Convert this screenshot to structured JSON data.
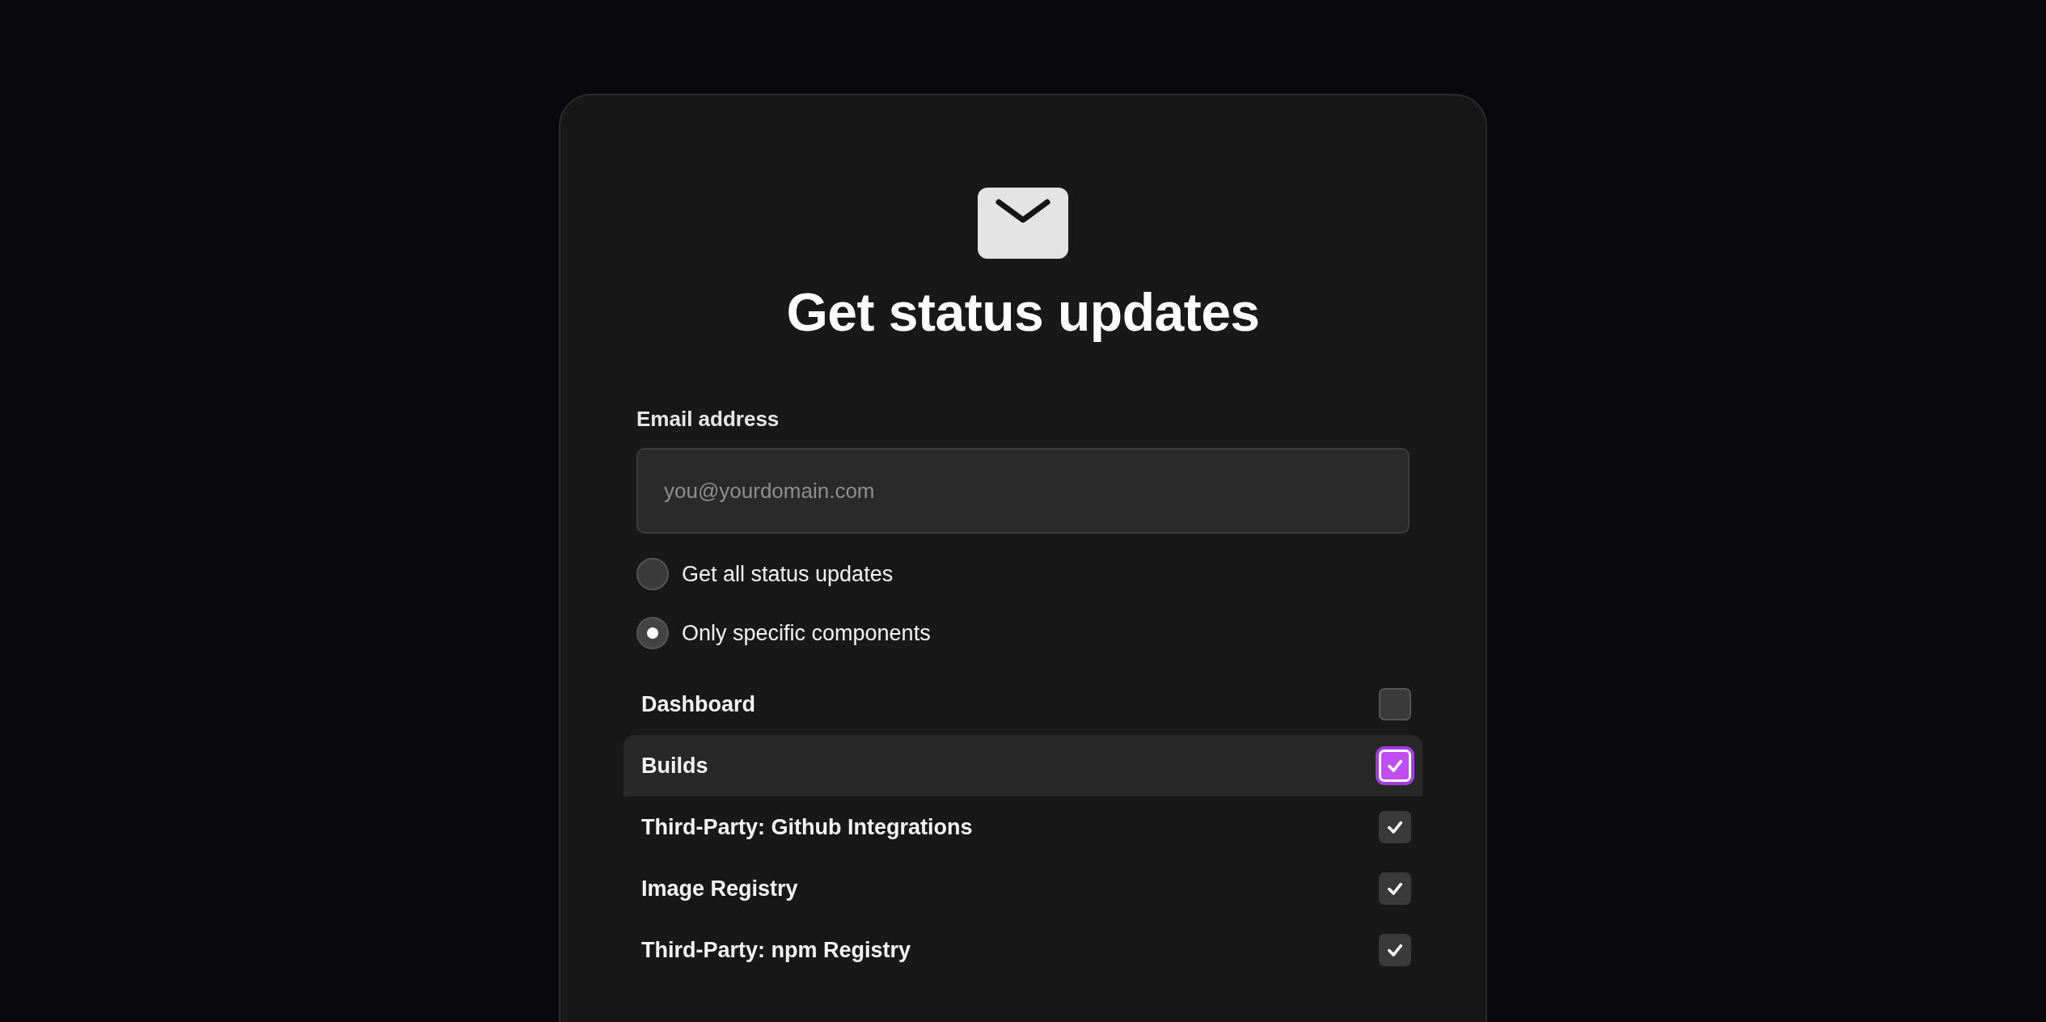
{
  "title": "Get status updates",
  "email": {
    "label": "Email address",
    "placeholder": "you@yourdomain.com"
  },
  "options": [
    {
      "label": "Get all status updates",
      "selected": false
    },
    {
      "label": "Only specific components",
      "selected": true
    }
  ],
  "components": [
    {
      "name": "Dashboard",
      "checked": false,
      "focused": false
    },
    {
      "name": "Builds",
      "checked": true,
      "focused": true
    },
    {
      "name": "Third-Party: Github Integrations",
      "checked": true,
      "focused": false
    },
    {
      "name": "Image Registry",
      "checked": true,
      "focused": false
    },
    {
      "name": "Third-Party: npm Registry",
      "checked": true,
      "focused": false
    }
  ]
}
